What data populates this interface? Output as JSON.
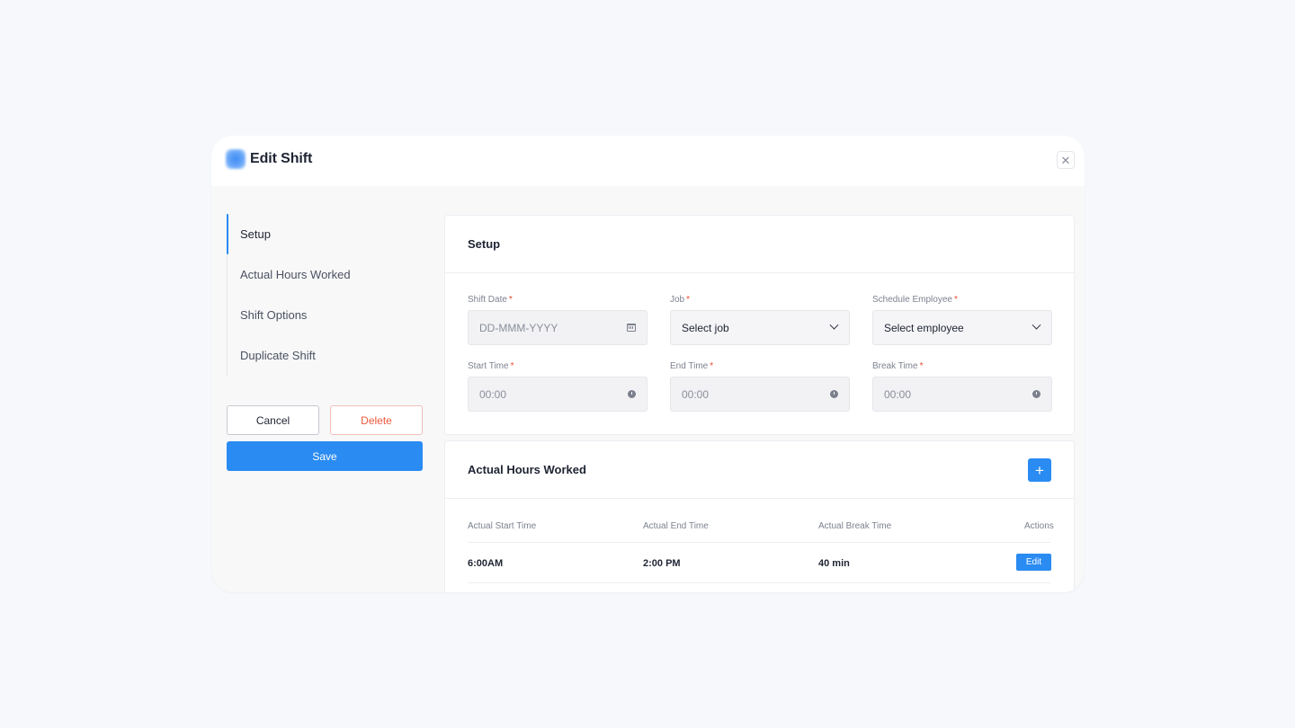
{
  "modal": {
    "title": "Edit Shift",
    "close_label": "✕"
  },
  "nav": {
    "items": [
      {
        "label": "Setup",
        "active": true
      },
      {
        "label": "Actual Hours Worked",
        "active": false
      },
      {
        "label": "Shift Options",
        "active": false
      },
      {
        "label": "Duplicate Shift",
        "active": false
      }
    ]
  },
  "actions": {
    "cancel_label": "Cancel",
    "delete_label": "Delete",
    "save_label": "Save"
  },
  "setup": {
    "title": "Setup",
    "required_mark": "*",
    "shift_date": {
      "label": "Shift Date",
      "placeholder": "DD-MMM-YYYY",
      "icon": "calendar-icon"
    },
    "job": {
      "label": "Job",
      "value": "Select job",
      "icon": "chevron-down-icon"
    },
    "employee": {
      "label": "Schedule Employee",
      "value": "Select employee",
      "icon": "chevron-down-icon"
    },
    "start_time": {
      "label": "Start Time",
      "placeholder": "00:00",
      "icon": "clock-icon"
    },
    "end_time": {
      "label": "End Time",
      "placeholder": "00:00",
      "icon": "clock-icon"
    },
    "break_time": {
      "label": "Break Time",
      "placeholder": "00:00",
      "icon": "clock-icon"
    }
  },
  "hours": {
    "title": "Actual Hours Worked",
    "add_label": "+",
    "columns": [
      "Actual Start Time",
      "Actual End Time",
      "Actual Break Time",
      "Actions"
    ],
    "rows": [
      {
        "start": "6:00AM",
        "end": "2:00 PM",
        "break": "40 min",
        "action": "Edit"
      }
    ]
  },
  "colors": {
    "accent": "#2a8bf2",
    "danger": "#ef5a3c",
    "background": "#f6f8fc"
  }
}
